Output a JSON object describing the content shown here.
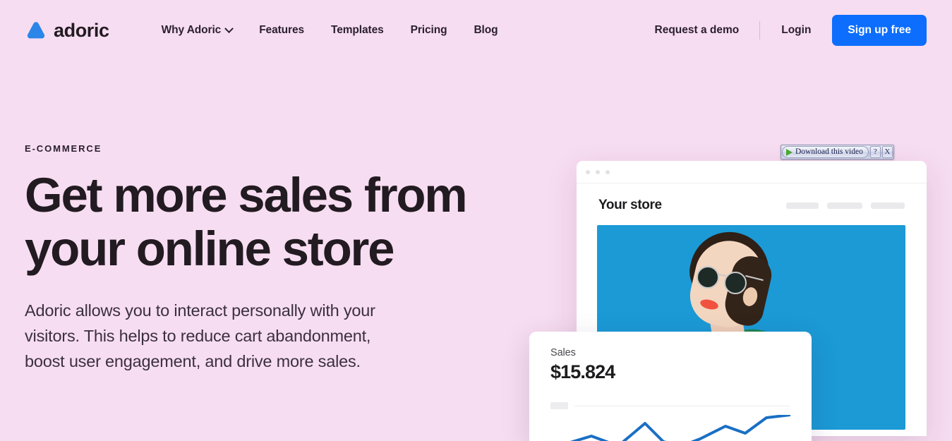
{
  "brand": {
    "name": "adoric",
    "logo_color": "#2b86e8"
  },
  "nav": {
    "links": [
      {
        "label": "Why Adoric",
        "has_dropdown": true
      },
      {
        "label": "Features",
        "has_dropdown": false
      },
      {
        "label": "Templates",
        "has_dropdown": false
      },
      {
        "label": "Pricing",
        "has_dropdown": false
      },
      {
        "label": "Blog",
        "has_dropdown": false
      }
    ],
    "demo_label": "Request a demo",
    "login_label": "Login",
    "signup_label": "Sign up free",
    "signup_color": "#0d6efd"
  },
  "hero": {
    "eyebrow": "E-COMMERCE",
    "title": "Get more sales from your online store",
    "subtitle": "Adoric allows you to interact personally with your visitors. This helps to reduce cart abandonment, boost user engagement, and drive more sales.",
    "background_color": "#f7ddf1"
  },
  "browser_mockup": {
    "store_title": "Your store",
    "photo_background": "#1b9ad6"
  },
  "sales_card": {
    "label": "Sales",
    "value": "$15.824",
    "line_color": "#1a6fc4"
  },
  "download_overlay": {
    "button_label": "Download this video",
    "help_label": "?",
    "close_label": "X"
  }
}
